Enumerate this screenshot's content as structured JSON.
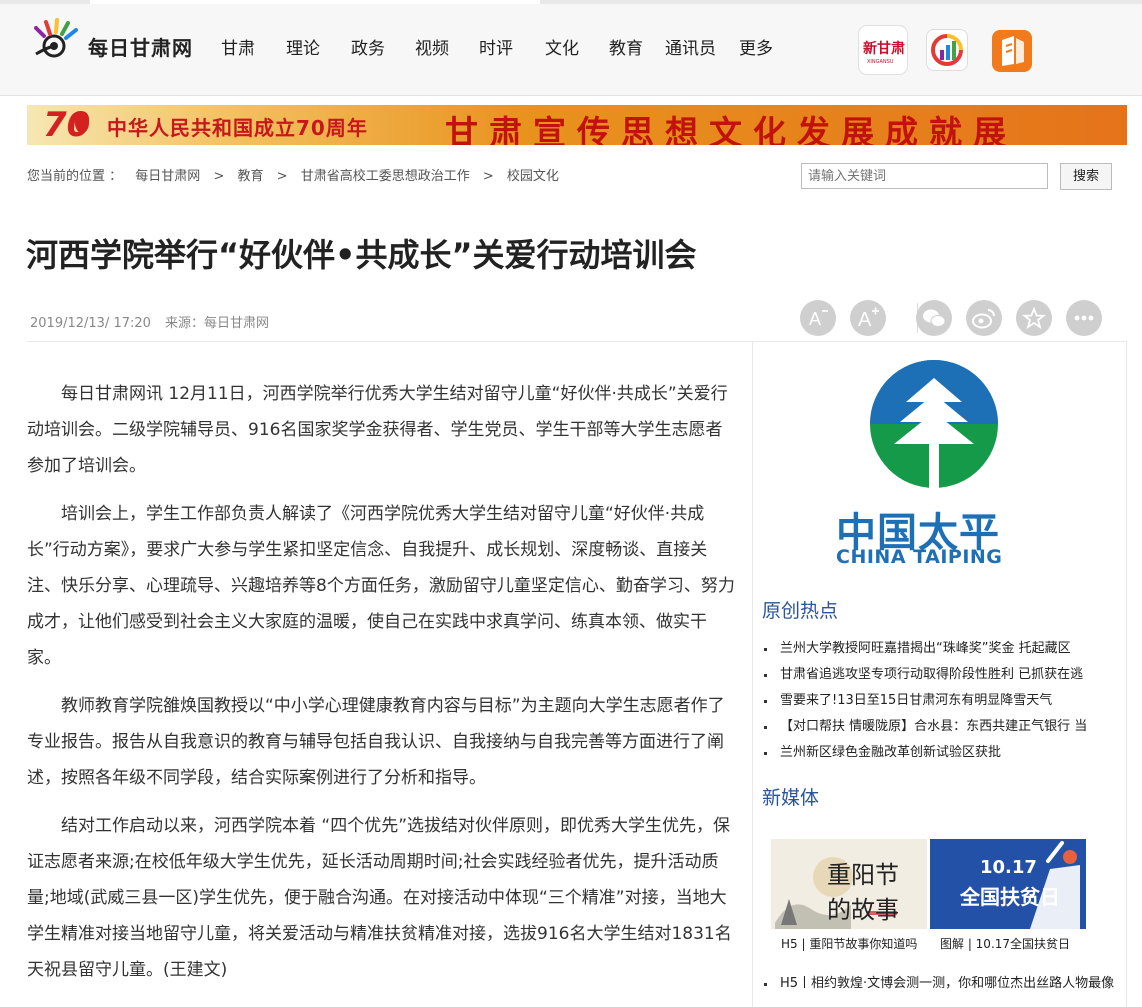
{
  "header": {
    "logo_text": "每日甘肃网",
    "nav": [
      "甘肃",
      "理论",
      "政务",
      "视频",
      "时评",
      "文化",
      "教育",
      "通讯员",
      "更多"
    ],
    "apps": [
      {
        "name": "xinganSu-app-icon",
        "text": "新甘肃",
        "sub": "XINGANSU"
      },
      {
        "name": "chart-app-icon"
      },
      {
        "name": "book-app-icon"
      }
    ]
  },
  "banner": {
    "number": "70",
    "text_left": "中华人民共和国成立70周年",
    "text_right": "甘肃宣传思想文化发展成就展"
  },
  "breadcrumb": {
    "prefix": "您当前的位置 ：",
    "items": [
      "每日甘肃网",
      "教育",
      "甘肃省高校工委思想政治工作",
      "校园文化"
    ],
    "sep": ">"
  },
  "search": {
    "placeholder": "请输入关键词",
    "button": "搜索"
  },
  "article": {
    "title": "河西学院举行“好伙伴•共成长”关爱行动培训会",
    "date": "2019/12/13/ 17:20",
    "source": "来源：每日甘肃网",
    "paragraphs": [
      "每日甘肃网讯 12月11日，河西学院举行优秀大学生结对留守儿童“好伙伴·共成长”关爱行动培训会。二级学院辅导员、916名国家奖学金获得者、学生党员、学生干部等大学生志愿者参加了培训会。",
      "培训会上，学生工作部负责人解读了《河西学院优秀大学生结对留守儿童“好伙伴·共成长”行动方案》，要求广大参与学生紧扣坚定信念、自我提升、成长规划、深度畅谈、直接关注、快乐分享、心理疏导、兴趣培养等8个方面任务，激励留守儿童坚定信心、勤奋学习、努力成才，让他们感受到社会主义大家庭的温暖，使自己在实践中求真学问、练真本领、做实干家。",
      "教师教育学院雒焕国教授以“中小学心理健康教育内容与目标”为主题向大学生志愿者作了专业报告。报告从自我意识的教育与辅导包括自我认识、自我接纳与自我完善等方面进行了阐述，按照各年级不同学段，结合实际案例进行了分析和指导。",
      "结对工作启动以来，河西学院本着 “四个优先”选拔结对伙伴原则，即优秀大学生优先，保证志愿者来源;在校低年级大学生优先，延长活动周期时间;社会实践经验者优先，提升活动质量;地域(武威三县一区)学生优先，便于融合沟通。在对接活动中体现“三个精准”对接，当地大学生精准对接当地留守儿童，将关爱活动与精准扶贫精准对接，选拔916名大学生结对1831名天祝县留守儿童。(王建文)"
    ]
  },
  "tools": {
    "font_smaller": "A-",
    "font_larger": "A+"
  },
  "sidebar": {
    "ad": {
      "cn": "中国太平",
      "en": "CHINA TAIPING"
    },
    "hot_title": "原创热点",
    "hot_items": [
      "兰州大学教授阿旺嘉措揭出“珠峰奖”奖金 托起藏区",
      "甘肃省追逃攻坚专项行动取得阶段性胜利 已抓获在逃",
      "雪要来了!13日至15日甘肃河东有明显降雪天气",
      "【对口帮扶 情暖陇原】合水县：东西共建正气银行 当",
      "兰州新区绿色金融改革创新试验区获批"
    ],
    "media_title": "新媒体",
    "media_cards": [
      {
        "caption": "H5 | 重阳节故事你知道吗",
        "img_text": "重阳节 的故事 你知道吗?"
      },
      {
        "caption": "图解 | 10.17全国扶贫日",
        "img_date": "10.17",
        "img_text": "全国扶贫日"
      }
    ],
    "more_items": [
      "H5丨相约敦煌·文博会测一测，你和哪位杰出丝路人物最像"
    ]
  }
}
